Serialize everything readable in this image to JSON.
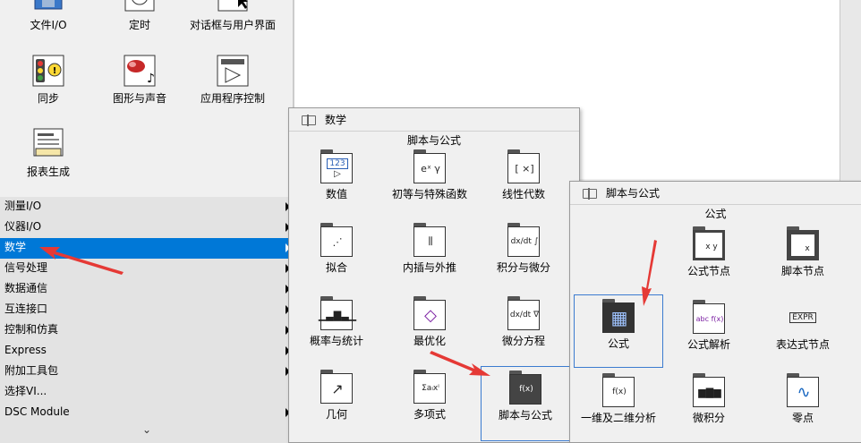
{
  "left_palette": {
    "icons": [
      {
        "label": "文件I/O",
        "icon": "file-io-icon"
      },
      {
        "label": "定时",
        "icon": "timing-icon"
      },
      {
        "label": "对话框与用户界面",
        "icon": "dialog-ui-icon"
      },
      {
        "label": "同步",
        "icon": "sync-icon"
      },
      {
        "label": "图形与声音",
        "icon": "graphics-sound-icon"
      },
      {
        "label": "应用程序控制",
        "icon": "app-control-icon"
      },
      {
        "label": "报表生成",
        "icon": "report-icon"
      }
    ],
    "menu": [
      {
        "label": "测量I/O",
        "submenu": true
      },
      {
        "label": "仪器I/O",
        "submenu": true
      },
      {
        "label": "数学",
        "submenu": true,
        "active": true
      },
      {
        "label": "信号处理",
        "submenu": true
      },
      {
        "label": "数据通信",
        "submenu": true
      },
      {
        "label": "互连接口",
        "submenu": true
      },
      {
        "label": "控制和仿真",
        "submenu": true
      },
      {
        "label": "Express",
        "submenu": true
      },
      {
        "label": "附加工具包",
        "submenu": true
      },
      {
        "label": "选择VI...",
        "submenu": false
      },
      {
        "label": "DSC Module",
        "submenu": true
      }
    ],
    "more": "⌄"
  },
  "math_popup": {
    "title": "数学",
    "subtitle": "脚本与公式",
    "items": [
      {
        "label": "数值",
        "glyph": "123"
      },
      {
        "label": "初等与特殊函数",
        "glyph": "eˣ γ"
      },
      {
        "label": "线性代数",
        "glyph": "[ ×]"
      },
      {
        "label": "拟合",
        "glyph": "⋰"
      },
      {
        "label": "内插与外推",
        "glyph": "⫼"
      },
      {
        "label": "积分与微分",
        "glyph": "dx/dt ∫"
      },
      {
        "label": "概率与统计",
        "glyph": "▁▃▇▃▁"
      },
      {
        "label": "最优化",
        "glyph": "◇"
      },
      {
        "label": "微分方程",
        "glyph": "dx/dt ∇"
      },
      {
        "label": "几何",
        "glyph": "↗"
      },
      {
        "label": "多项式",
        "glyph": "Σaᵢxⁱ"
      },
      {
        "label": "脚本与公式",
        "glyph": "f(x)"
      }
    ]
  },
  "script_popup": {
    "title": "脚本与公式",
    "subtitle": "公式",
    "items": [
      {
        "label": "公式节点",
        "glyph": "x y"
      },
      {
        "label": "脚本节点",
        "glyph": "x"
      },
      {
        "label": "公式",
        "glyph": "▦"
      },
      {
        "label": "公式解析",
        "glyph": "abc f(x)"
      },
      {
        "label": "表达式节点",
        "glyph": "EXPR"
      },
      {
        "label": "一维及二维分析",
        "glyph": "f(x)"
      },
      {
        "label": "微积分",
        "glyph": "▆▇▆"
      },
      {
        "label": "零点",
        "glyph": "∿"
      }
    ]
  },
  "colors": {
    "highlight": "#0078d7",
    "selection_border": "#3b7bd0",
    "annotation_arrow": "#e53935"
  }
}
